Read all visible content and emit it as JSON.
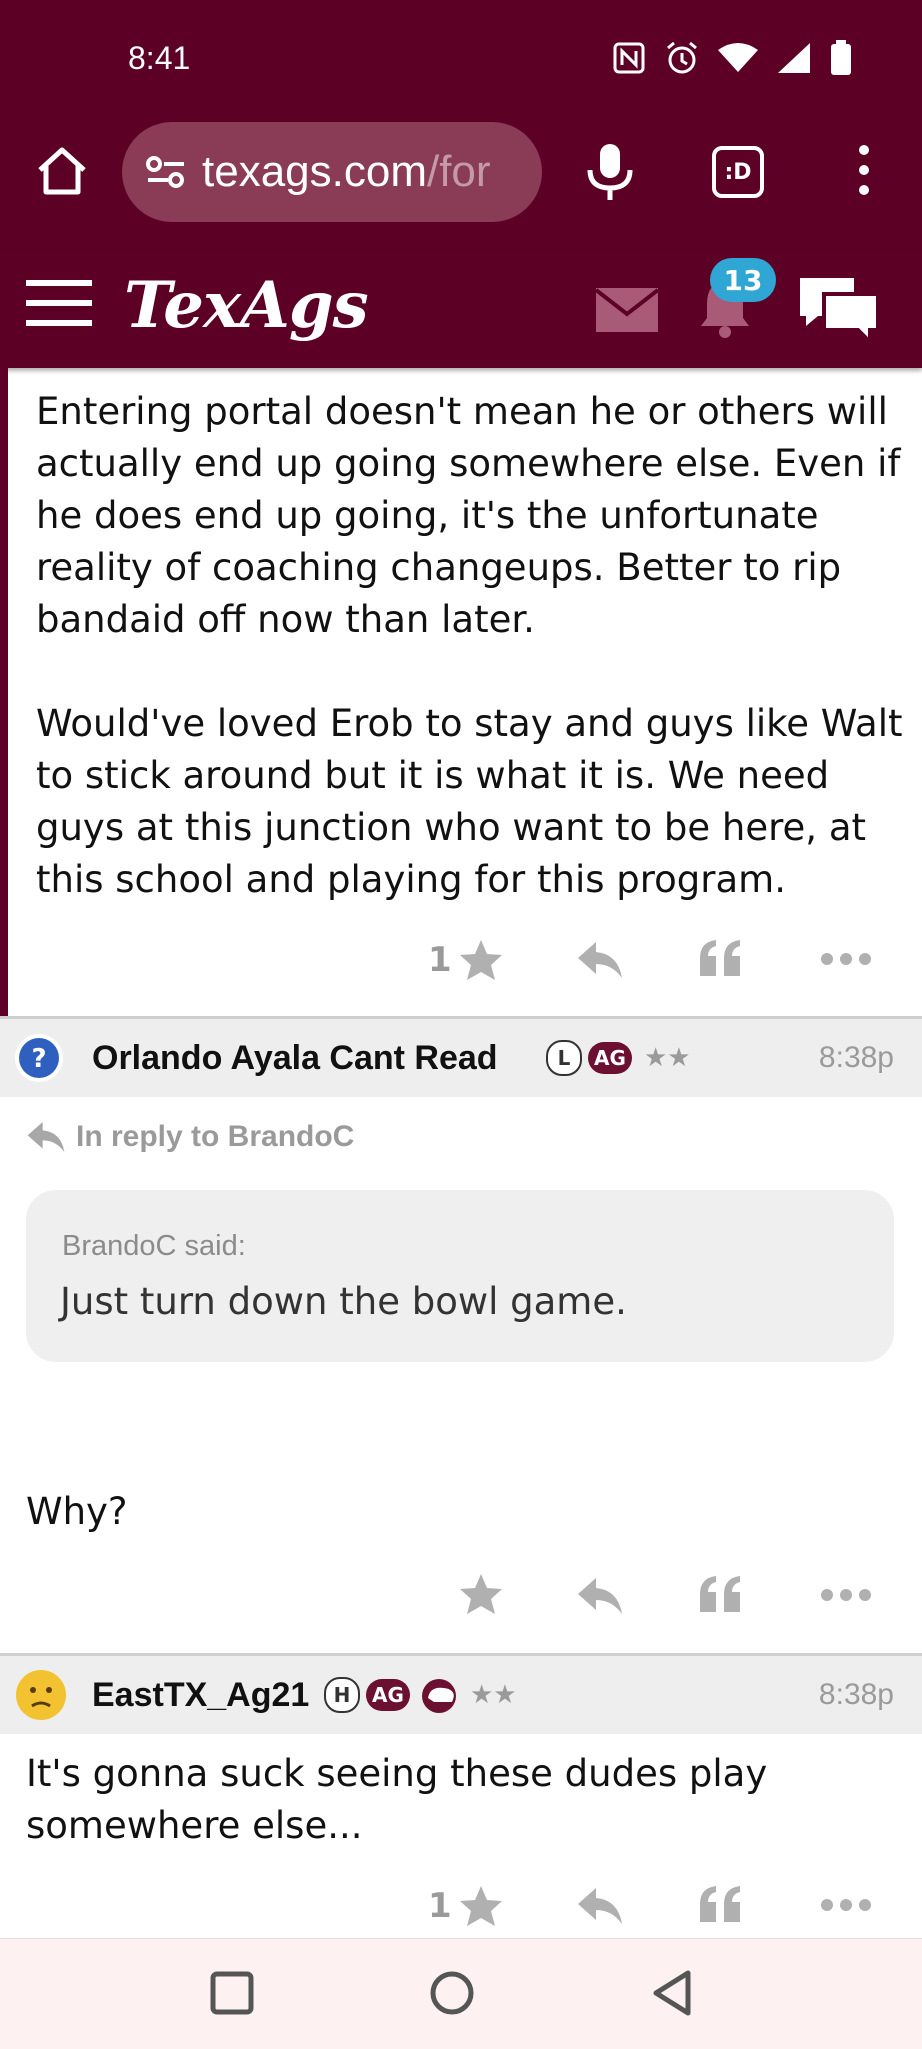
{
  "status_bar": {
    "time": "8:41"
  },
  "browser": {
    "url_host": "texags.com",
    "url_rest": "/for"
  },
  "site": {
    "logo": "TexAgs",
    "notification_count": "13"
  },
  "post1": {
    "paragraphs": [
      "Entering portal doesn't mean he or others will actually end up going somewhere else. Even if he does end up going, it's the unfortunate reality of coaching changeups. Better to rip bandaid off now than later.",
      "Would've loved Erob to stay and guys like Walt to stick around but it is what it is. We need guys at this junction who want to be here, at this school and playing for this program."
    ],
    "star_count": "1"
  },
  "post2": {
    "username": "Orlando Ayala Cant Read",
    "badges": [
      "L",
      "AG"
    ],
    "rating": "★★",
    "time": "8:38p",
    "reply_to": "In reply to BrandoC",
    "quote_author": "BrandoC said:",
    "quote_text": "Just turn down the bowl game.",
    "body": "Why?"
  },
  "post3": {
    "username": "EastTX_Ag21",
    "badges": [
      "H",
      "AG"
    ],
    "rating": "★★",
    "time": "8:38p",
    "body": "It's gonna suck seeing these dudes play somewhere else...",
    "star_count": "1"
  },
  "colors": {
    "maroon": "#5c0025",
    "badge_blue": "#2fa6d3",
    "icon_gray": "#9a9a9a"
  }
}
